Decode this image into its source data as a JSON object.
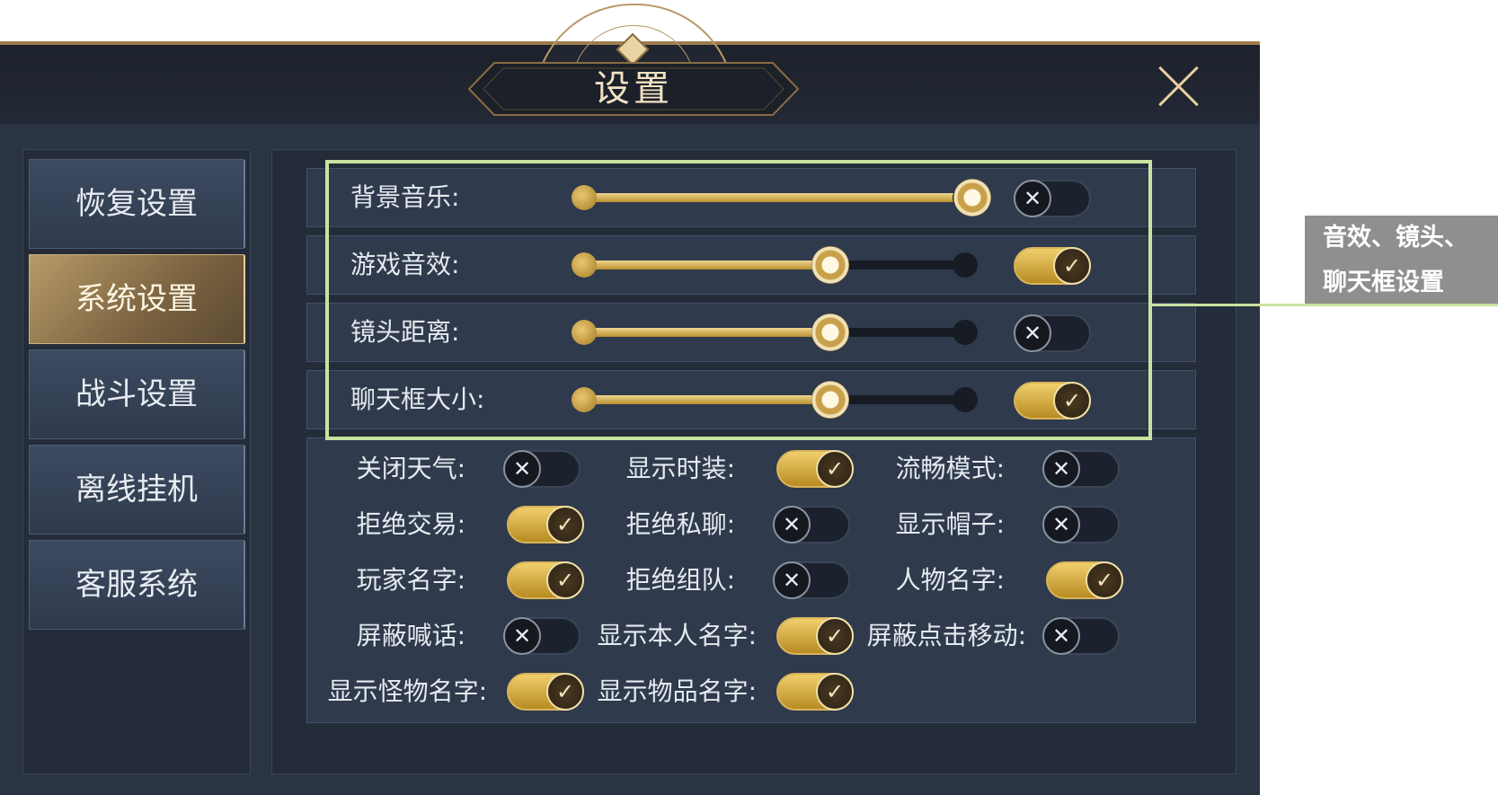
{
  "header": {
    "title": "设置"
  },
  "sidebar": {
    "items": [
      {
        "label": "恢复设置"
      },
      {
        "label": "系统设置",
        "active": true
      },
      {
        "label": "战斗设置"
      },
      {
        "label": "离线挂机"
      },
      {
        "label": "客服系统"
      }
    ]
  },
  "sliders": [
    {
      "label": "背景音乐:",
      "value": 1.0,
      "toggle_on": false
    },
    {
      "label": "游戏音效:",
      "value": 0.64,
      "toggle_on": true
    },
    {
      "label": "镜头距离:",
      "value": 0.64,
      "toggle_on": false
    },
    {
      "label": "聊天框大小:",
      "value": 0.64,
      "toggle_on": true
    }
  ],
  "checkboxes": [
    {
      "label": "关闭天气:",
      "on": false
    },
    {
      "label": "显示时装:",
      "on": true
    },
    {
      "label": "流畅模式:",
      "on": false
    },
    {
      "label": "拒绝交易:",
      "on": true
    },
    {
      "label": "拒绝私聊:",
      "on": false
    },
    {
      "label": "显示帽子:",
      "on": false
    },
    {
      "label": "玩家名字:",
      "on": true
    },
    {
      "label": "拒绝组队:",
      "on": false
    },
    {
      "label": "人物名字:",
      "on": true
    },
    {
      "label": "屏蔽喊话:",
      "on": false
    },
    {
      "label": "显示本人名字:",
      "on": true
    },
    {
      "label": "屏蔽点击移动:",
      "on": false
    },
    {
      "label": "显示怪物名字:",
      "on": true
    },
    {
      "label": "显示物品名字:",
      "on": true
    }
  ],
  "annotation": {
    "line1": "音效、镜头、",
    "line2": "聊天框设置"
  },
  "icons": {
    "on": "check-icon",
    "off": "cross-icon",
    "close": "close-icon"
  },
  "colors": {
    "accent_gold": "#d8b45a",
    "highlight": "#c9e3a1",
    "panel": "#2f3a4c"
  }
}
